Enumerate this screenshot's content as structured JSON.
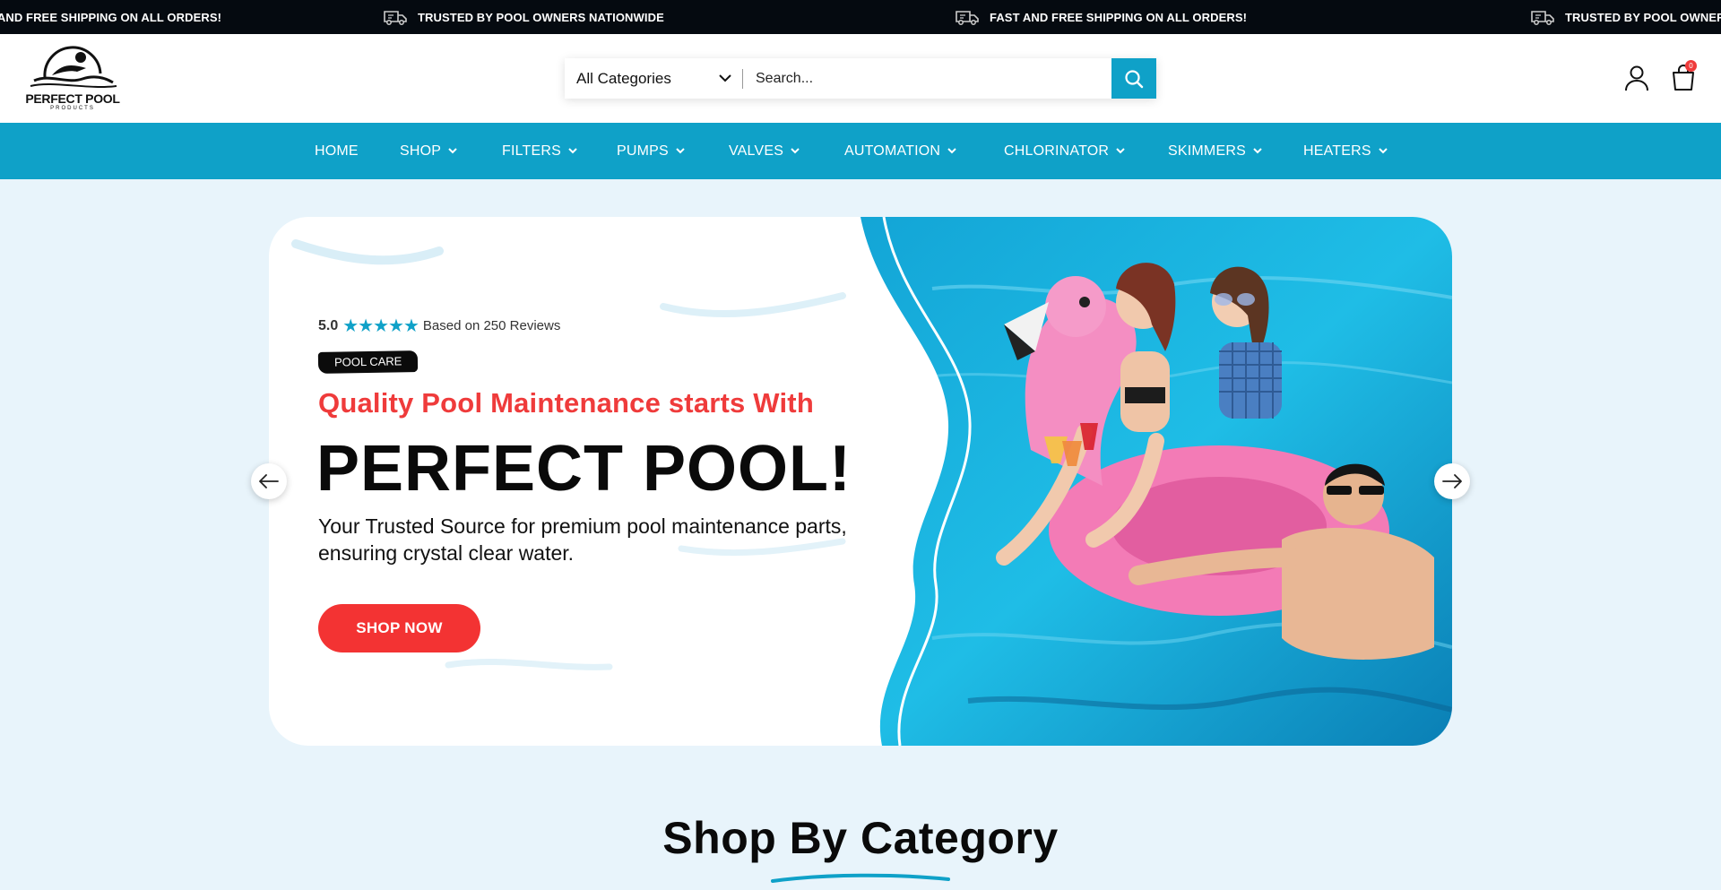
{
  "announcements": [
    "FAST AND FREE SHIPPING ON ALL ORDERS!",
    "TRUSTED BY POOL OWNERS NATIONWIDE",
    "FAST AND FREE SHIPPING ON ALL ORDERS!",
    "TRUSTED BY POOL OWNERS NATIONWIDE"
  ],
  "logo": {
    "name": "PERFECT POOL",
    "sub": "PRODUCTS"
  },
  "search": {
    "category": "All Categories",
    "placeholder": "Search..."
  },
  "cart": {
    "count": "0"
  },
  "nav": {
    "items": [
      "HOME",
      "SHOP",
      "FILTERS",
      "PUMPS",
      "VALVES",
      "AUTOMATION",
      "CHLORINATOR",
      "SKIMMERS",
      "HEATERS"
    ]
  },
  "hero": {
    "rating_score": "5.0",
    "stars": "★★★★★",
    "rating_text": "Based on 250 Reviews",
    "tag": "POOL CARE",
    "subheading": "Quality Pool Maintenance starts With",
    "headline": "PERFECT POOL!",
    "description": "Your Trusted Source for premium pool maintenance parts, ensuring crystal clear water.",
    "cta": "SHOP NOW"
  },
  "section": {
    "title": "Shop By Category"
  },
  "colors": {
    "accent": "#0fa1c8",
    "cta": "#f33333",
    "subheading": "#ef3b3b",
    "announce_bg": "#050a10",
    "page_bg": "#e8f4fb"
  },
  "icons": [
    "truck-icon",
    "chevron-down-icon",
    "search-icon",
    "user-icon",
    "cart-icon",
    "arrow-left-icon",
    "arrow-right-icon"
  ]
}
